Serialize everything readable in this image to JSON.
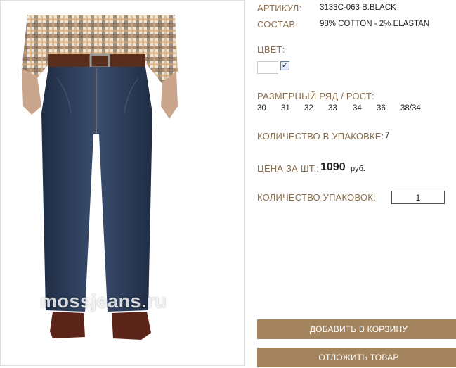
{
  "product": {
    "article_label": "АРТИКУЛ:",
    "article_value": "3133C-063 B.BLACK",
    "composition_label": "СОСТАВ:",
    "composition_value": "98% COTTON - 2% ELASTAN",
    "color_label": "ЦВЕТ:",
    "color_selected": true,
    "sizes_label": "РАЗМЕРНЫЙ РЯД / РОСТ:",
    "sizes": [
      "30",
      "31",
      "32",
      "33",
      "34",
      "36",
      "38/34"
    ],
    "pack_qty_label": "КОЛИЧЕСТВО В УПАКОВКЕ:",
    "pack_qty_value": "7",
    "price_label": "ЦЕНА ЗА ШТ.:",
    "price_value": "1090",
    "price_currency": "руб.",
    "packs_label": "КОЛИЧЕСТВО УПАКОВОК:",
    "packs_value": "1"
  },
  "image": {
    "watermark": "mossjeans.ru"
  },
  "buttons": {
    "add_to_cart": "ДОБАВИТЬ В КОРЗИНУ",
    "save_item": "ОТЛОЖИТЬ ТОВАР"
  },
  "colors": {
    "label": "#8b6f4e",
    "button": "#a5855f",
    "denim": "#2b3a55"
  }
}
